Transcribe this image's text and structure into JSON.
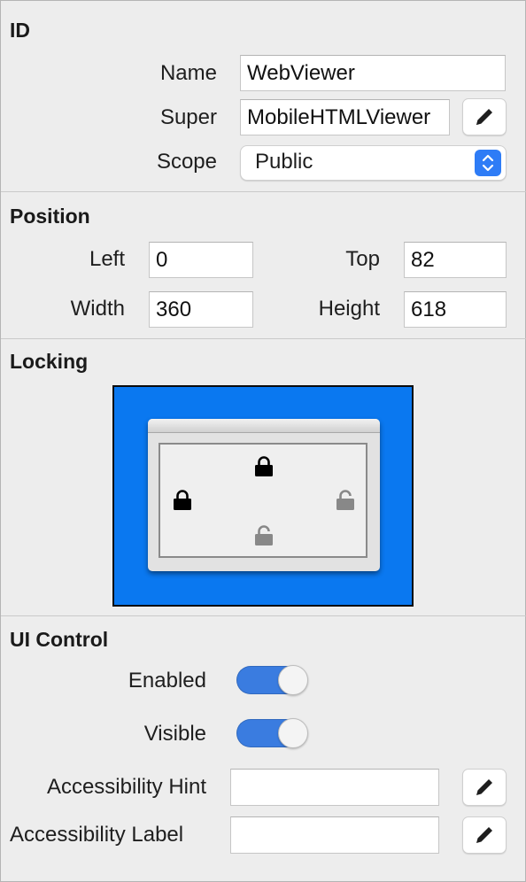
{
  "id_section": {
    "title": "ID",
    "name_label": "Name",
    "name_value": "WebViewer",
    "super_label": "Super",
    "super_value": "MobileHTMLViewer",
    "scope_label": "Scope",
    "scope_value": "Public"
  },
  "position_section": {
    "title": "Position",
    "left_label": "Left",
    "left_value": "0",
    "top_label": "Top",
    "top_value": "82",
    "width_label": "Width",
    "width_value": "360",
    "height_label": "Height",
    "height_value": "618"
  },
  "locking_section": {
    "title": "Locking",
    "locks": {
      "top": "locked",
      "left": "locked",
      "right": "unlocked",
      "bottom": "unlocked"
    },
    "background_color": "#0a78f0"
  },
  "ui_control_section": {
    "title": "UI Control",
    "enabled_label": "Enabled",
    "enabled": true,
    "visible_label": "Visible",
    "visible": true,
    "accessibility_hint_label": "Accessibility Hint",
    "accessibility_hint_value": "",
    "accessibility_label_label": "Accessibility Label",
    "accessibility_label_value": ""
  },
  "colors": {
    "accent": "#2e7cf6",
    "toggle_on": "#3a7ce0"
  },
  "icons": {
    "edit": "pencil-icon",
    "select": "up-down-chevron-icon",
    "locked": "lock-closed-icon",
    "unlocked": "lock-open-icon"
  }
}
